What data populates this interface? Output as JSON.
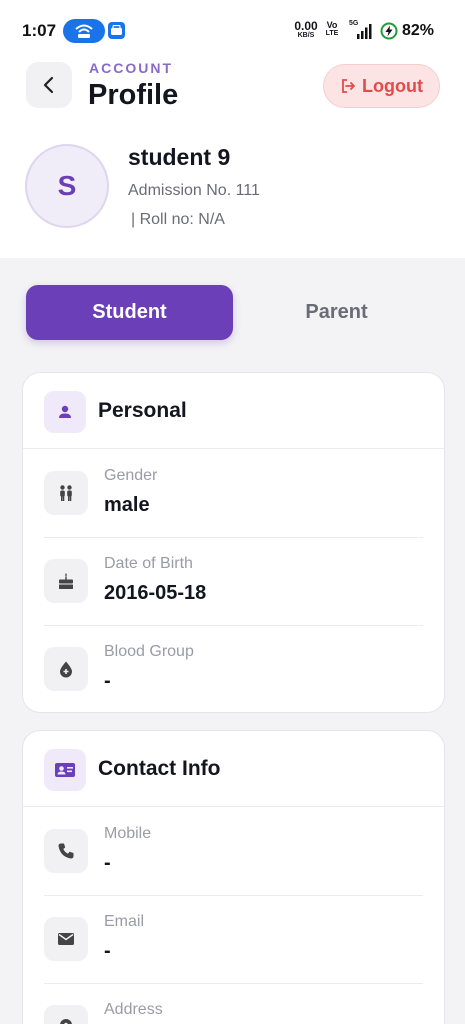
{
  "status_bar": {
    "time": "1:07",
    "net_speed": "0.00",
    "net_speed_unit": "KB/S",
    "volte_top": "Vo",
    "volte_bottom": "LTE",
    "network_type": "5G",
    "battery": "82%"
  },
  "header": {
    "eyebrow": "ACCOUNT",
    "title": "Profile",
    "logout_label": "Logout"
  },
  "profile": {
    "initial": "S",
    "name": "student 9",
    "admission": "Admission No. 111",
    "roll": "| Roll no: N/A"
  },
  "tabs": [
    {
      "label": "Student",
      "active": true
    },
    {
      "label": "Parent",
      "active": false
    }
  ],
  "sections": {
    "personal": {
      "title": "Personal",
      "icon": "person-icon",
      "rows": [
        {
          "label": "Gender",
          "value": "male",
          "icon": "people-icon"
        },
        {
          "label": "Date of Birth",
          "value": "2016-05-18",
          "icon": "cake-icon"
        },
        {
          "label": "Blood Group",
          "value": "-",
          "icon": "blood-drop-icon"
        }
      ]
    },
    "contact": {
      "title": "Contact Info",
      "icon": "contact-card-icon",
      "rows": [
        {
          "label": "Mobile",
          "value": "-",
          "icon": "phone-icon"
        },
        {
          "label": "Email",
          "value": "-",
          "icon": "mail-icon"
        },
        {
          "label": "Address",
          "value": "",
          "icon": "location-icon"
        }
      ]
    }
  },
  "colors": {
    "accent": "#6a3fb8",
    "logout_bg": "#fde4e4",
    "logout_text": "#e34b4b",
    "background": "#f3f3f5"
  }
}
